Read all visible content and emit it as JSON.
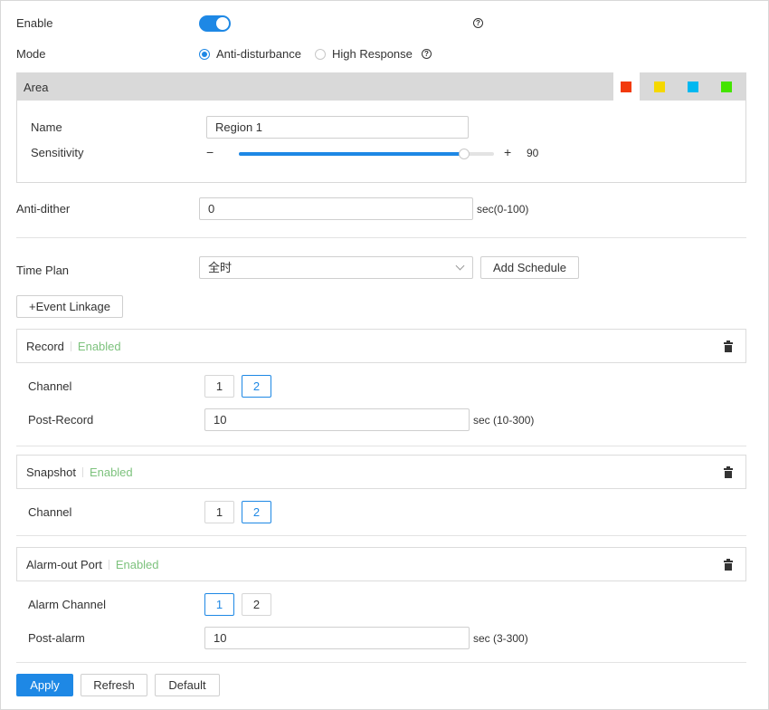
{
  "enable": {
    "label": "Enable",
    "on": true
  },
  "mode": {
    "label": "Mode",
    "options": [
      {
        "label": "Anti-disturbance",
        "selected": true
      },
      {
        "label": "High Response",
        "selected": false
      }
    ]
  },
  "area": {
    "label": "Area",
    "colors": [
      "#f23a0c",
      "#f5d800",
      "#00b8f0",
      "#44e400"
    ],
    "name_label": "Name",
    "name_value": "Region 1",
    "sensitivity_label": "Sensitivity",
    "sensitivity_minus": "−",
    "sensitivity_plus": "+",
    "sensitivity_value": 90
  },
  "anti_dither": {
    "label": "Anti-dither",
    "value": "0",
    "unit": "sec(0-100)"
  },
  "time_plan": {
    "label": "Time Plan",
    "value": "全时",
    "add_schedule": "Add Schedule"
  },
  "event_linkage": {
    "label": "+Event Linkage"
  },
  "record": {
    "title": "Record",
    "status": "Enabled",
    "channel_label": "Channel",
    "channels": [
      {
        "label": "1",
        "selected": false
      },
      {
        "label": "2",
        "selected": true
      }
    ],
    "post_label": "Post-Record",
    "post_value": "10",
    "post_unit": "sec (10-300)"
  },
  "snapshot": {
    "title": "Snapshot",
    "status": "Enabled",
    "channel_label": "Channel",
    "channels": [
      {
        "label": "1",
        "selected": false
      },
      {
        "label": "2",
        "selected": true
      }
    ]
  },
  "alarm_out": {
    "title": "Alarm-out Port",
    "status": "Enabled",
    "channel_label": "Alarm Channel",
    "channels": [
      {
        "label": "1",
        "selected": true
      },
      {
        "label": "2",
        "selected": false
      }
    ],
    "post_label": "Post-alarm",
    "post_value": "10",
    "post_unit": "sec (3-300)"
  },
  "footer": {
    "apply": "Apply",
    "refresh": "Refresh",
    "default": "Default"
  },
  "icons": {
    "help": "question-circle-icon",
    "delete": "trash-icon",
    "dropdown": "chevron-down-icon"
  }
}
